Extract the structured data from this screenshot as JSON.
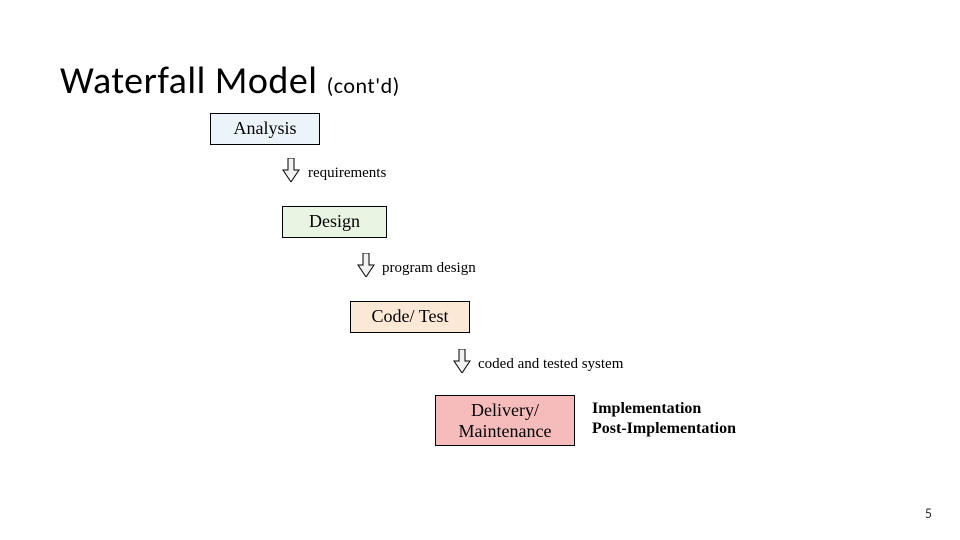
{
  "title_main": "Waterfall Model ",
  "title_sub": "(cont'd)",
  "stages": {
    "analysis": "Analysis",
    "design": "Design",
    "code": "Code/ Test",
    "delivery_line1": "Delivery/",
    "delivery_line2": "Maintenance"
  },
  "transitions": {
    "requirements": "requirements",
    "program_design": "program design",
    "coded_tested": "coded and tested system"
  },
  "side_note_line1": "Implementation",
  "side_note_line2": "Post-Implementation",
  "slide_number": "5",
  "colors": {
    "analysis_bg": "#eaf4f9",
    "design_bg": "#e8f5e2",
    "code_bg": "#fce9d5",
    "delivery_bg": "#f6bcbc"
  }
}
